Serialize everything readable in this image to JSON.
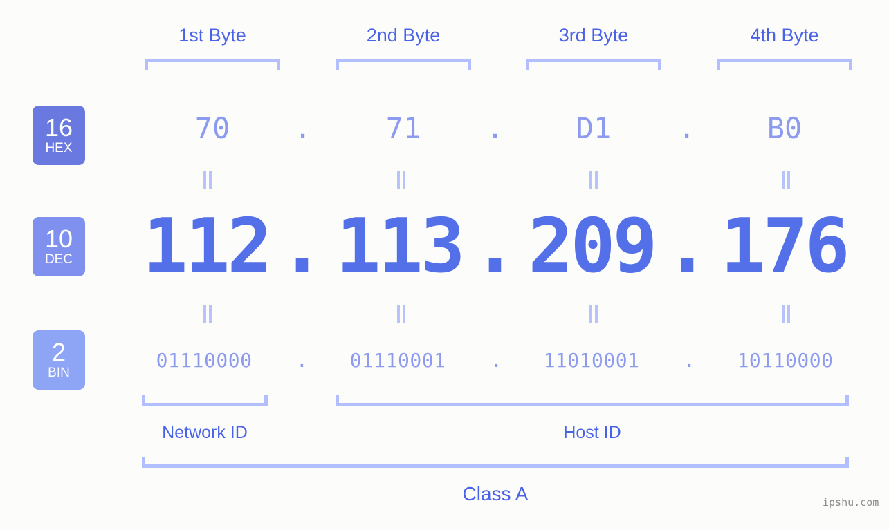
{
  "background_color": "#fcfdfa",
  "accent_colors": {
    "label_blue": "#4a62e8",
    "bracket_blue": "#b3beff",
    "light_value_blue": "#8c9bf0",
    "dec_blue": "#5470e8",
    "badge_hex": "#6a79e0",
    "badge_dec": "#8090ee",
    "badge_bin": "#8ea5f5",
    "watermark_gray": "#8c8c8c"
  },
  "byte_headers": [
    {
      "label": "1st Byte"
    },
    {
      "label": "2nd Byte"
    },
    {
      "label": "3rd Byte"
    },
    {
      "label": "4th Byte"
    }
  ],
  "bases": [
    {
      "number": "16",
      "name": "HEX",
      "color": "#6a79e0"
    },
    {
      "number": "10",
      "name": "DEC",
      "color": "#8090ee"
    },
    {
      "number": "2",
      "name": "BIN",
      "color": "#8ea5f5"
    }
  ],
  "rows": {
    "hex": {
      "octets": [
        "70",
        "71",
        "D1",
        "B0"
      ],
      "separator": "."
    },
    "dec": {
      "octets": [
        "112",
        "113",
        "209",
        "176"
      ],
      "separator": "."
    },
    "bin": {
      "octets": [
        "01110000",
        "01110001",
        "11010001",
        "10110000"
      ],
      "separator": "."
    }
  },
  "equality_marks": {
    "glyph": "=",
    "count_per_gap": 4
  },
  "footer": {
    "network_id_label": "Network ID",
    "host_id_label": "Host ID",
    "class_label": "Class A"
  },
  "watermark": {
    "text": "ipshu.com"
  }
}
